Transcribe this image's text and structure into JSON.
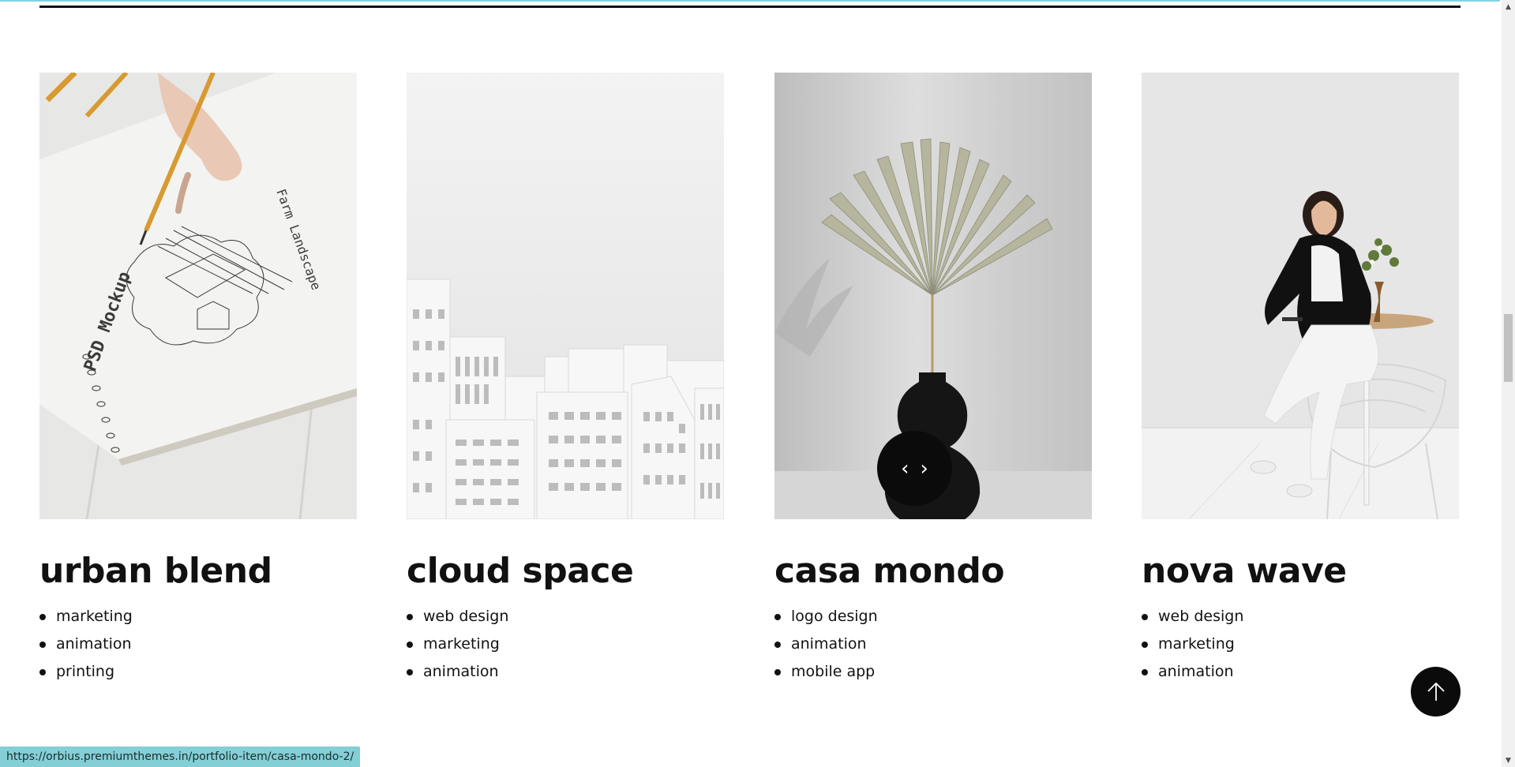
{
  "portfolio": {
    "items": [
      {
        "title": "urban blend",
        "tags": [
          "marketing",
          "animation",
          "printing"
        ],
        "image": "sketchbook-photo"
      },
      {
        "title": "cloud space",
        "tags": [
          "web design",
          "marketing",
          "animation"
        ],
        "image": "paper-city-photo"
      },
      {
        "title": "casa mondo",
        "tags": [
          "logo design",
          "animation",
          "mobile app"
        ],
        "image": "vase-palm-photo"
      },
      {
        "title": "nova wave",
        "tags": [
          "web design",
          "marketing",
          "animation"
        ],
        "image": "woman-cafe-photo"
      }
    ],
    "drag_cursor": {
      "left_glyph": "‹",
      "right_glyph": "›"
    },
    "mockup_text": {
      "line1": "PSD Mockup",
      "line2": "Farm Landscape"
    }
  },
  "status_bar": {
    "url": "https://orbius.premiumthemes.in/portfolio-item/casa-mondo-2/"
  },
  "colors": {
    "accent": "#7fd3de",
    "status_bg": "#84cfd6",
    "ink": "#111111"
  },
  "icons": [
    "drag-arrows-icon",
    "arrow-up-icon",
    "scroll-up-arrow-icon",
    "scroll-down-arrow-icon"
  ]
}
